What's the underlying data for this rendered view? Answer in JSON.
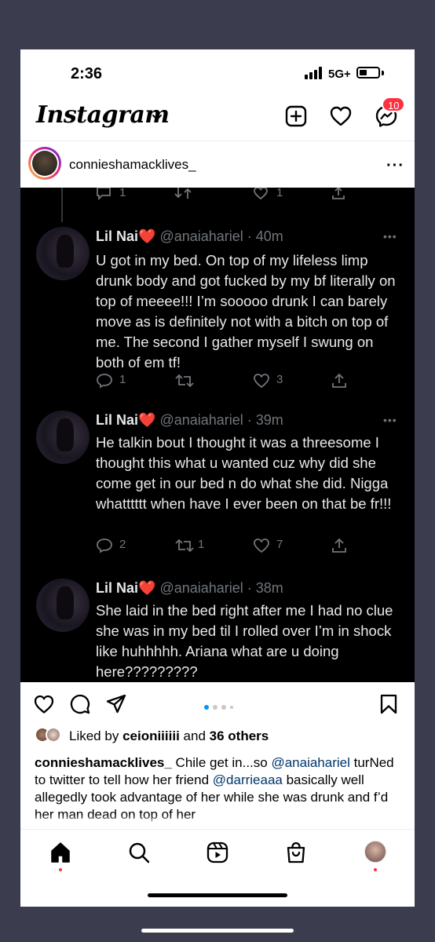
{
  "status_bar": {
    "time": "2:36",
    "network": "5G+",
    "battery_level": 0.4
  },
  "header": {
    "app_name": "Instagram",
    "notification_count": "10"
  },
  "post": {
    "username": "conniesha​mack​lives_",
    "tweets": [
      {
        "name": "Lil Nai",
        "handle": "@anaiahariel · 40m",
        "text": "U got in my bed. On top of my lifeless limp drunk body and got fucked by my bf literally on top of meeee!!! I’m sooooo drunk I can barely move as is definitely not with a bitch on top of me. The second I gather myself I swung on both of em tf!",
        "replies": "1",
        "retweets": "",
        "likes": "3"
      },
      {
        "name": "Lil Nai",
        "handle": "@anaiahariel · 39m",
        "text": "He talkin bout I thought it was a threesome I thought this what u wanted cuz why did she come get in our bed n do what she did. Nigga whatttttt when have I ever been on that be fr!!!",
        "replies": "2",
        "retweets": "1",
        "likes": "7"
      },
      {
        "name": "Lil Nai",
        "handle": "@anaiahariel · 38m",
        "text": "She laid in the bed right after me I had no clue she was in my bed til I rolled over I’m in shock like huhhhhh. Ariana what are u doing here?????????",
        "replies": "",
        "retweets": "",
        "likes": ""
      }
    ],
    "top_partial_actions": {
      "replies": "1",
      "likes": "1"
    },
    "carousel": {
      "total": 4,
      "active": 1
    },
    "likes": {
      "prefix": "Liked by",
      "user": "ceioniiiiii",
      "and": "and",
      "others": "36 others"
    },
    "caption": {
      "username": "conniesha​mack​lives_",
      "part1": " Chile get in...so ",
      "mention1": "@anaiahariel",
      "part2": " turNed to twitter to tell how her friend ",
      "mention2": "@darrieaaa",
      "part3": " basically well allegedly took advantage of her while she was drunk and f’d her man dead on top of her"
    }
  },
  "colors": {
    "twitter_bg": "#000000",
    "ig_badge": "#ff3040",
    "carousel_active": "#0095f6"
  },
  "icons": [
    "plus-square-icon",
    "heart-icon",
    "messenger-icon",
    "more-icon",
    "comment-icon",
    "share-icon",
    "bookmark-icon",
    "home-icon",
    "search-icon",
    "reels-icon",
    "shop-icon",
    "profile-icon"
  ]
}
